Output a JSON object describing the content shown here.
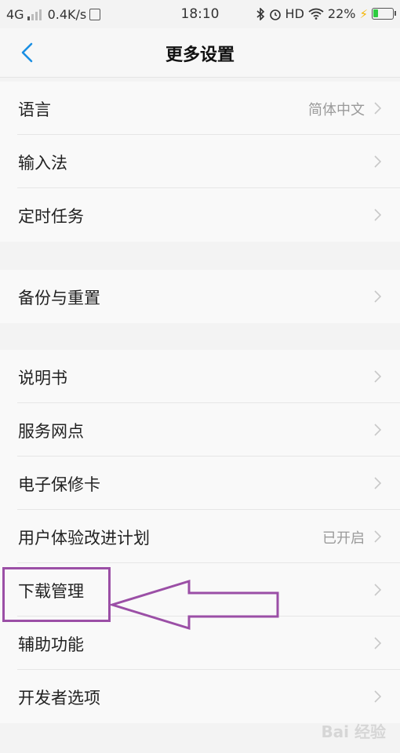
{
  "status_bar": {
    "network": "4G",
    "speed": "0.4K/s",
    "time": "18:10",
    "hd": "HD",
    "battery": "22%"
  },
  "header": {
    "title": "更多设置"
  },
  "groups": [
    {
      "items": [
        {
          "label": "语言",
          "value": "简体中文"
        },
        {
          "label": "输入法",
          "value": ""
        },
        {
          "label": "定时任务",
          "value": ""
        }
      ]
    },
    {
      "items": [
        {
          "label": "备份与重置",
          "value": ""
        }
      ]
    },
    {
      "items": [
        {
          "label": "说明书",
          "value": ""
        },
        {
          "label": "服务网点",
          "value": ""
        },
        {
          "label": "电子保修卡",
          "value": ""
        },
        {
          "label": "用户体验改进计划",
          "value": "已开启"
        },
        {
          "label": "下载管理",
          "value": ""
        },
        {
          "label": "辅助功能",
          "value": ""
        },
        {
          "label": "开发者选项",
          "value": ""
        }
      ]
    }
  ],
  "watermark": "Bai 经验",
  "colors": {
    "accent": "#1a8fe3",
    "annotation": "#9b4fa6"
  }
}
